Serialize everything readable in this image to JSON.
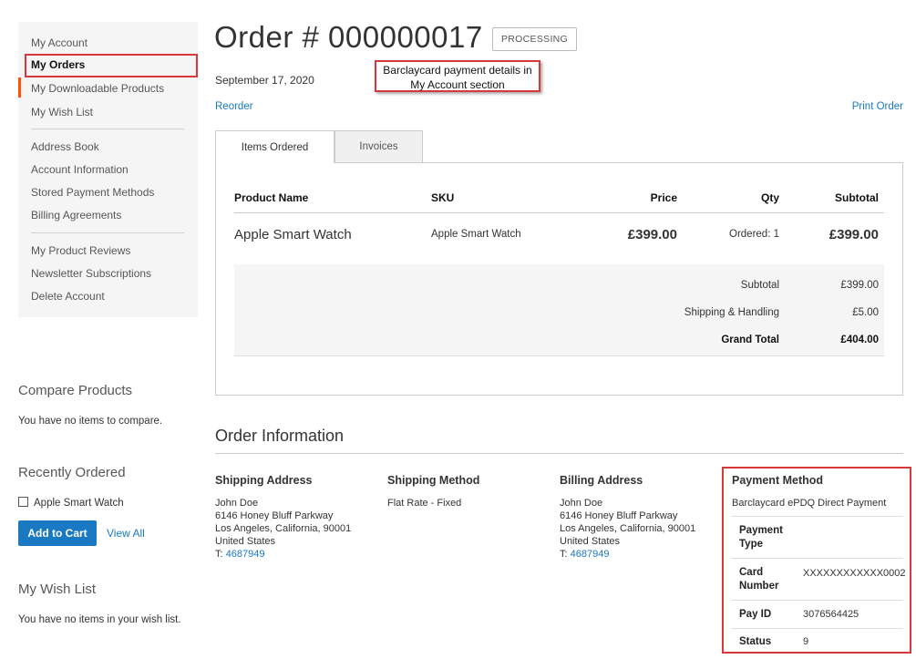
{
  "account_nav": {
    "items": [
      {
        "label": "My Account"
      },
      {
        "label": "My Orders"
      },
      {
        "label": "My Downloadable Products"
      },
      {
        "label": "My Wish List"
      },
      {
        "label": "Address Book"
      },
      {
        "label": "Account Information"
      },
      {
        "label": "Stored Payment Methods"
      },
      {
        "label": "Billing Agreements"
      },
      {
        "label": "My Product Reviews"
      },
      {
        "label": "Newsletter Subscriptions"
      },
      {
        "label": "Delete Account"
      }
    ],
    "current": "My Orders",
    "accent_color": "#ff5501"
  },
  "compare": {
    "title": "Compare Products",
    "empty_text": "You have no items to compare."
  },
  "recently_ordered": {
    "title": "Recently Ordered",
    "item": "Apple Smart Watch",
    "add_to_cart": "Add to Cart",
    "view_all": "View All"
  },
  "wishlist": {
    "title": "My Wish List",
    "empty_text": "You have no items in your wish list."
  },
  "order": {
    "title": "Order # 000000017",
    "status": "PROCESSING",
    "date": "September 17, 2020",
    "reorder": "Reorder",
    "print": "Print Order"
  },
  "callout": {
    "line1": "Barclaycard payment details in",
    "line2": "My Account section",
    "border_color": "#d9383a"
  },
  "tabs": [
    {
      "label": "Items Ordered",
      "active": true
    },
    {
      "label": "Invoices",
      "active": false
    }
  ],
  "items_table": {
    "headers": {
      "product": "Product Name",
      "sku": "SKU",
      "price": "Price",
      "qty": "Qty",
      "subtotal": "Subtotal"
    },
    "rows": [
      {
        "product": "Apple Smart Watch",
        "sku": "Apple Smart Watch",
        "price": "£399.00",
        "qty": "Ordered: 1",
        "subtotal": "£399.00"
      }
    ],
    "totals": [
      {
        "label": "Subtotal",
        "value": "£399.00"
      },
      {
        "label": "Shipping & Handling",
        "value": "£5.00"
      },
      {
        "label": "Grand Total",
        "value": "£404.00"
      }
    ]
  },
  "order_info": {
    "title": "Order Information",
    "shipping_address": {
      "title": "Shipping Address",
      "lines": [
        "John Doe",
        "6146 Honey Bluff Parkway",
        "Los Angeles, California, 90001",
        "United States"
      ],
      "phone_prefix": "T: ",
      "phone": "4687949"
    },
    "shipping_method": {
      "title": "Shipping Method",
      "value": "Flat Rate - Fixed"
    },
    "billing_address": {
      "title": "Billing Address",
      "lines": [
        "John Doe",
        "6146 Honey Bluff Parkway",
        "Los Angeles, California, 90001",
        "United States"
      ],
      "phone_prefix": "T: ",
      "phone": "4687949"
    },
    "payment_method": {
      "title": "Payment Method",
      "name": "Barclaycard ePDQ Direct Payment",
      "rows": [
        {
          "label": "Payment Type",
          "value": ""
        },
        {
          "label": "Card Number",
          "value": "XXXXXXXXXXXX0002"
        },
        {
          "label": "Pay ID",
          "value": "3076564425"
        },
        {
          "label": "Status",
          "value": "9"
        }
      ]
    }
  }
}
